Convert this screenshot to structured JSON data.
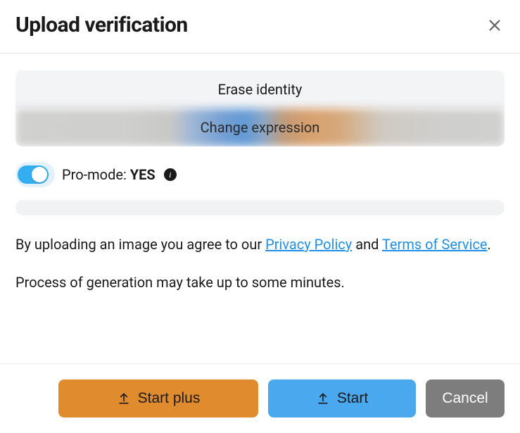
{
  "header": {
    "title": "Upload verification"
  },
  "segments": {
    "erase": "Erase identity",
    "change": "Change expression"
  },
  "pro": {
    "label": "Pro-mode: ",
    "value": "YES"
  },
  "agree": {
    "prefix": "By uploading an image you agree to our ",
    "privacy": "Privacy Policy",
    "mid": " and ",
    "terms": "Terms of Service",
    "suffix": "."
  },
  "note": "Process of generation may take up to some minutes.",
  "footer": {
    "start_plus": "Start plus",
    "start": "Start",
    "cancel": "Cancel"
  }
}
